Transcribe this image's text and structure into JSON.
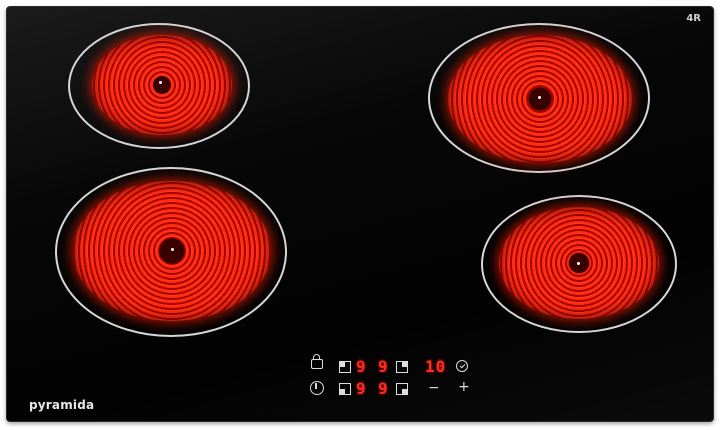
{
  "brand": "pyramida",
  "corner_mark": "4R",
  "display": {
    "row1": {
      "d1": "9",
      "d2": "9",
      "timer": "10"
    },
    "row2": {
      "d1": "9",
      "d2": "9"
    }
  },
  "controls": {
    "minus": "−",
    "plus": "+"
  },
  "icons": [
    "lock-icon",
    "power-icon",
    "timer-icon",
    "zone-select-icon",
    "minus-icon",
    "plus-icon"
  ],
  "colors": {
    "glass": "#050505",
    "element": "#ff2a12",
    "ring": "#d7d7d7",
    "display": "#ff2b22"
  }
}
